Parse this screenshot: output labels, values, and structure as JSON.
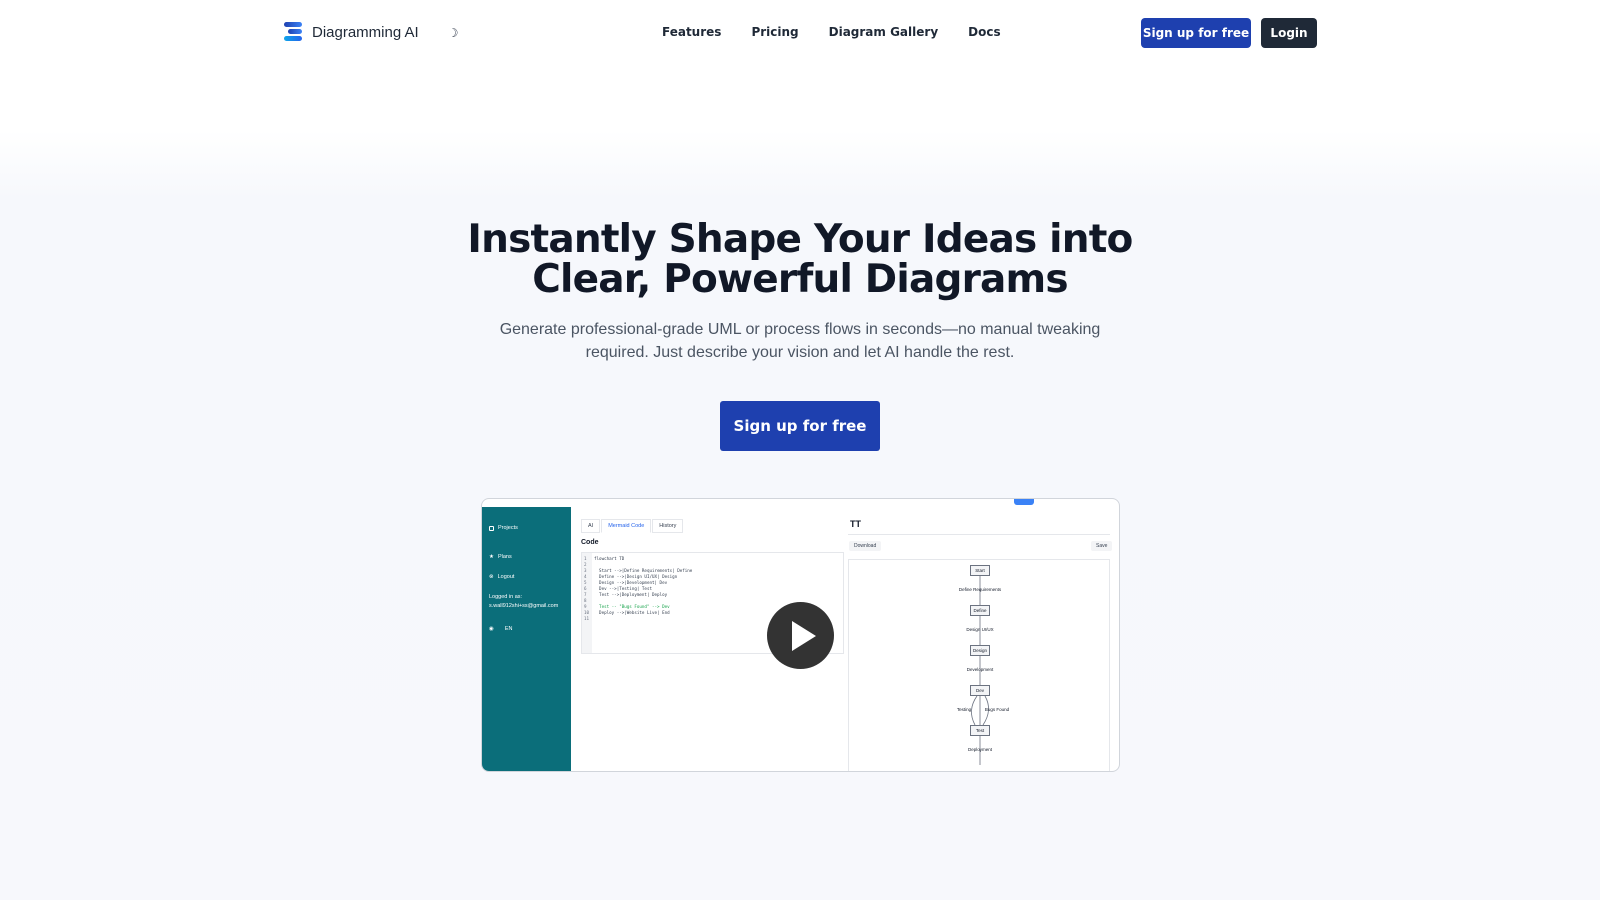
{
  "nav": {
    "brand": "Diagramming AI",
    "links": [
      "Features",
      "Pricing",
      "Diagram Gallery",
      "Docs"
    ],
    "signup_label": "Sign up for free",
    "login_label": "Login"
  },
  "hero": {
    "title_line1": "Instantly Shape Your Ideas into",
    "title_line2": "Clear, Powerful Diagrams",
    "subtitle_line1": "Generate professional-grade UML or process flows in seconds—no manual tweaking",
    "subtitle_line2": "required. Just describe your vision and let AI handle the rest.",
    "cta_label": "Sign up for free"
  },
  "preview": {
    "sidebar": {
      "projects": "Projects",
      "plans": "Plans",
      "logout": "Logout",
      "logged_in_label": "Logged in as:",
      "email": "s.wall912shi+ss@gmail.com",
      "language": "EN"
    },
    "tabs": [
      "AI",
      "Mermaid Code",
      "History"
    ],
    "code_label": "Code",
    "code_lines": [
      "flowchart TD",
      "",
      "  Start -->|Define Requirements| Define",
      "  Define -->|Design UI/UX| Design",
      "  Design -->|Development| Dev",
      "  Dev -->|Testing| Test",
      "  Test -->|Deployment| Deploy",
      "",
      "  Test -- \"Bugs Found\" --> Dev",
      "  Deploy -->|Website Live| End",
      ""
    ],
    "diagram_title": "TT",
    "download_label": "Download",
    "save_label": "Save",
    "diagram": {
      "nodes": [
        "Start",
        "Define",
        "Design",
        "Dev",
        "Test"
      ],
      "edge_labels": [
        "Define Requirements",
        "Design UI/UX",
        "Development",
        "Testing",
        "Bugs Found",
        "Deployment"
      ]
    }
  }
}
